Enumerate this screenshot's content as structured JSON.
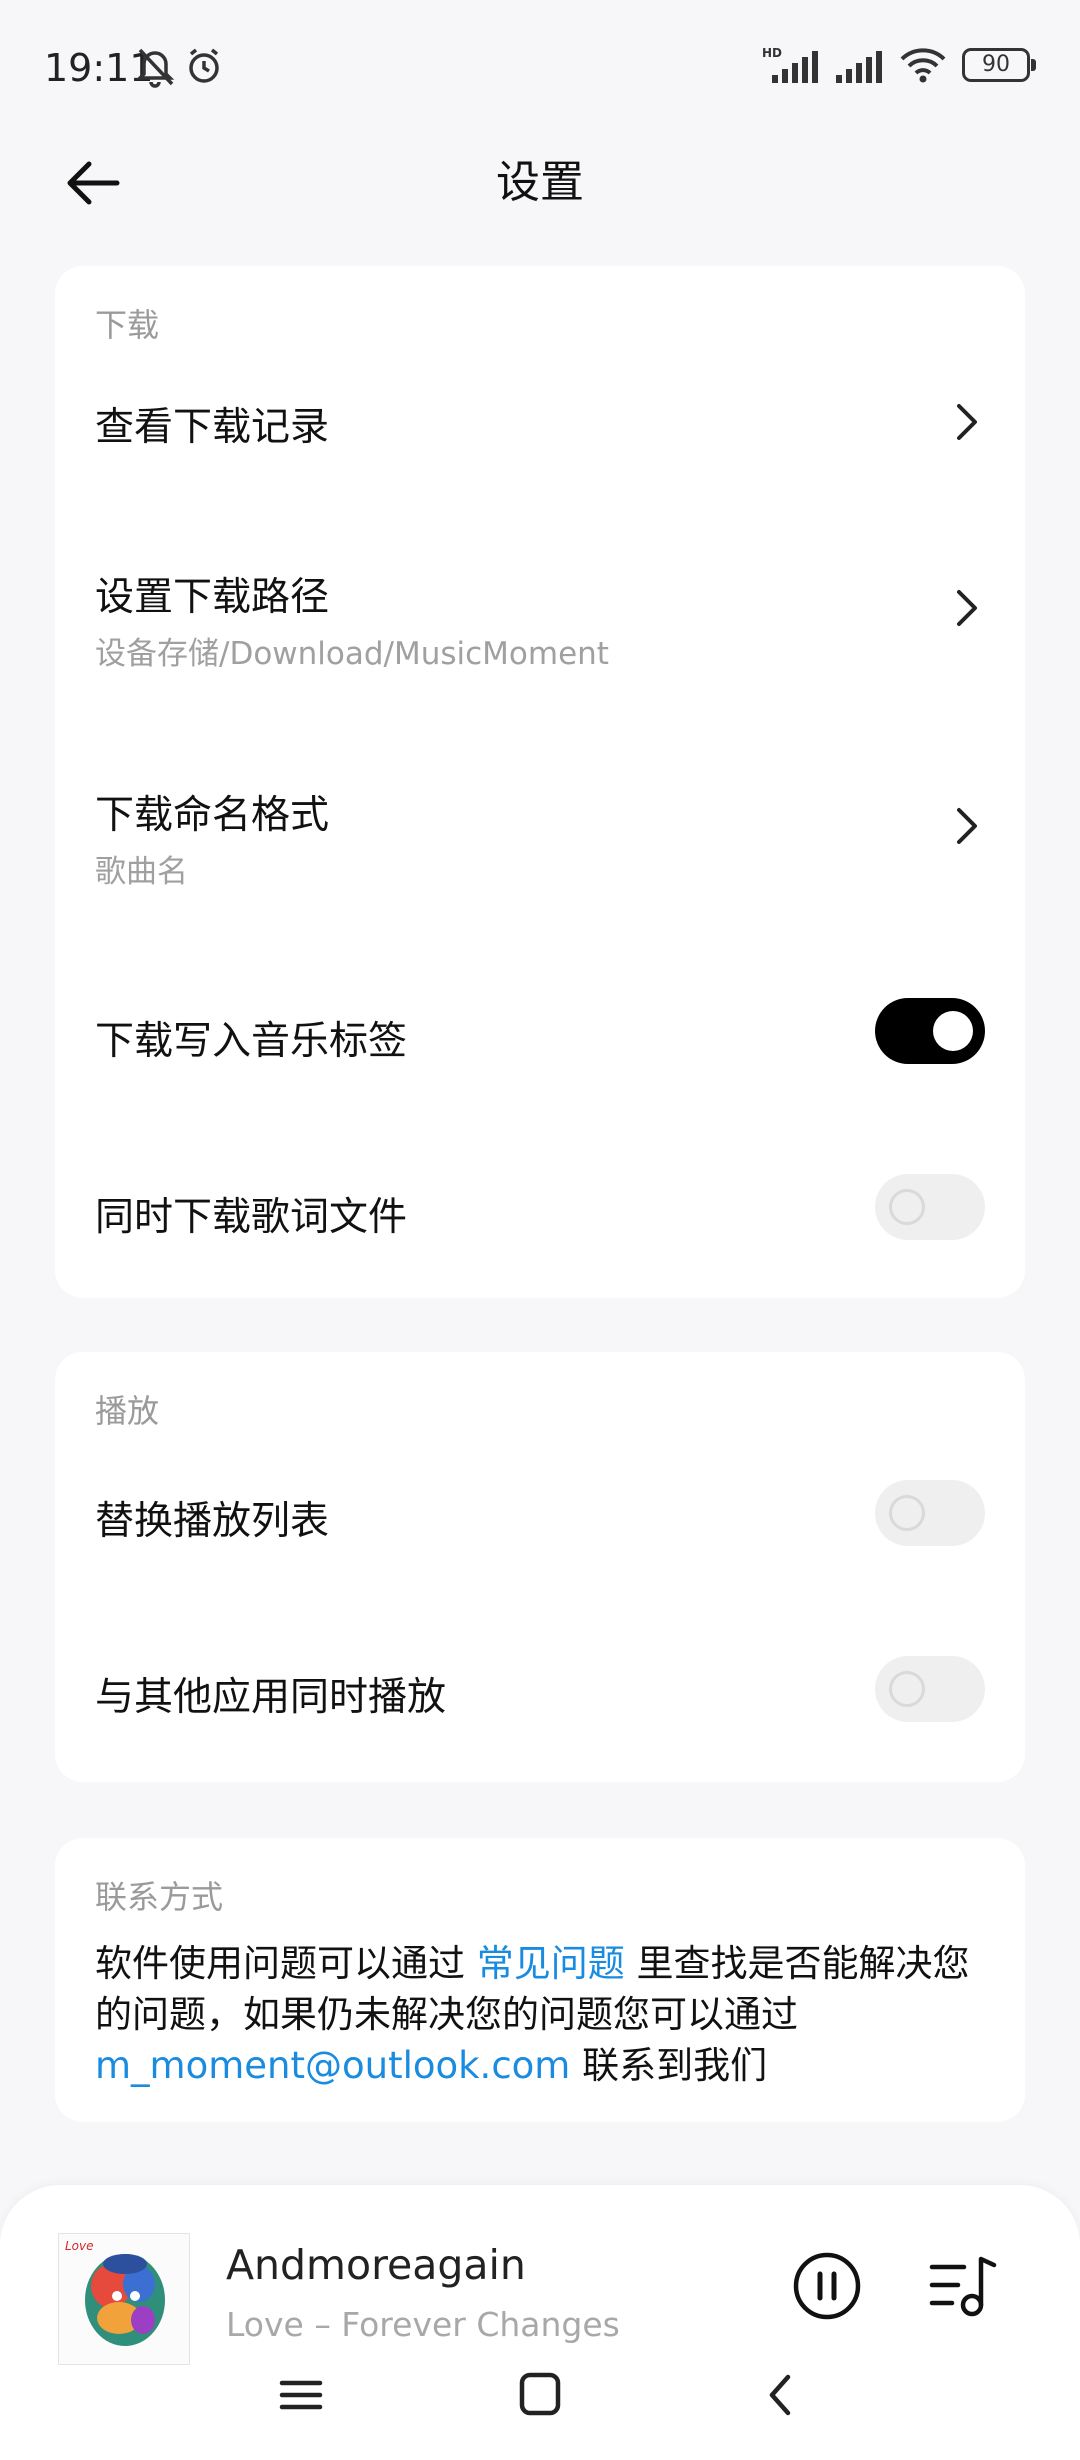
{
  "status_bar": {
    "time": "19:11",
    "battery": "90"
  },
  "header": {
    "title": "设置"
  },
  "download_section": {
    "title": "下载",
    "items": [
      {
        "label": "查看下载记录",
        "type": "link"
      },
      {
        "label": "设置下载路径",
        "sub": "设备存储/Download/MusicMoment",
        "type": "link"
      },
      {
        "label": "下载命名格式",
        "sub": "歌曲名",
        "type": "link"
      },
      {
        "label": "下载写入音乐标签",
        "type": "toggle",
        "on": true
      },
      {
        "label": "同时下载歌词文件",
        "type": "toggle",
        "on": false
      }
    ]
  },
  "playback_section": {
    "title": "播放",
    "items": [
      {
        "label": "替换播放列表",
        "type": "toggle",
        "on": false
      },
      {
        "label": "与其他应用同时播放",
        "type": "toggle",
        "on": false
      }
    ]
  },
  "contact_section": {
    "title": "联系方式",
    "text_1": "软件使用问题可以通过 ",
    "faq_link": "常见问题",
    "text_2": " 里查找是否能解决您的问题，如果仍未解决您的问题您可以通过 ",
    "email_link": "m_moment@outlook.com",
    "text_3": " 联系到我们"
  },
  "player": {
    "song_title": "Andmoreagain",
    "song_sub": "Love – Forever Changes"
  },
  "colors": {
    "accent_link": "#1a8ce0",
    "toggle_on": "#000000",
    "background": "#f7f7f9"
  }
}
